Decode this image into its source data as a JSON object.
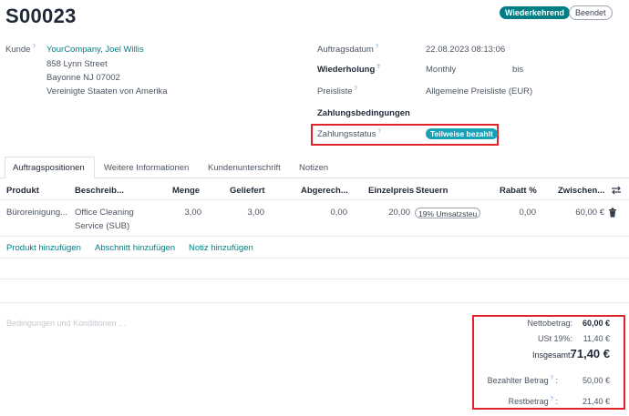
{
  "header": {
    "order_number": "S00023",
    "badge_recurring": "Wiederkehrend",
    "badge_ended": "Beendet"
  },
  "form": {
    "customer_label": "Kunde",
    "customer_name": "YourCompany, Joel Willis",
    "address_line1": "858 Lynn Street",
    "address_line2": "Bayonne NJ 07002",
    "address_line3": "Vereinigte Staaten von Amerika",
    "order_date_label": "Auftragsdatum",
    "order_date_value": "22.08.2023 08:13:06",
    "recurrence_label": "Wiederholung",
    "recurrence_value": "Monthly",
    "recurrence_until": "bis",
    "pricelist_label": "Preisliste",
    "pricelist_value": "Allgemeine Preisliste (EUR)",
    "payment_terms_label": "Zahlungsbedingungen",
    "payment_status_label": "Zahlungsstatus",
    "payment_status_value": "Teilweise bezahlt"
  },
  "tabs": [
    "Auftragspositionen",
    "Weitere Informationen",
    "Kundenunterschrift",
    "Notizen"
  ],
  "table": {
    "headers": [
      "Produkt",
      "Beschreib...",
      "Menge",
      "Geliefert",
      "Abgerech...",
      "Einzelpreis",
      "Steuern",
      "Rabatt %",
      "Zwischen..."
    ],
    "row": {
      "product": "Büroreinigung...",
      "description_line1": "Office Cleaning",
      "description_line2": "Service (SUB)",
      "quantity": "3,00",
      "delivered": "3,00",
      "invoiced": "0,00",
      "unit_price": "20,00",
      "tax": "19% Umsatzsteu",
      "discount": "0,00",
      "subtotal": "60,00 €"
    },
    "add_product": "Produkt hinzufügen",
    "add_section": "Abschnitt hinzufügen",
    "add_note": "Notiz hinzufügen"
  },
  "terms_placeholder": "Bedingungen und Konditionen ...",
  "totals": {
    "net_label": "Nettobetrag:",
    "net_value": "60,00 €",
    "vat_label": "USt 19%:",
    "vat_value": "11,40 €",
    "total_label": "Insgesamt:",
    "total_value": "71,40 €",
    "paid_label": "Bezahlter Betrag",
    "paid_value": "50,00 €",
    "rest_label": "Restbetrag",
    "rest_value": "21,40 €"
  },
  "colors": {
    "accent": "#017e84",
    "status_pill": "#17a2b8",
    "highlight": "#e0242a"
  }
}
